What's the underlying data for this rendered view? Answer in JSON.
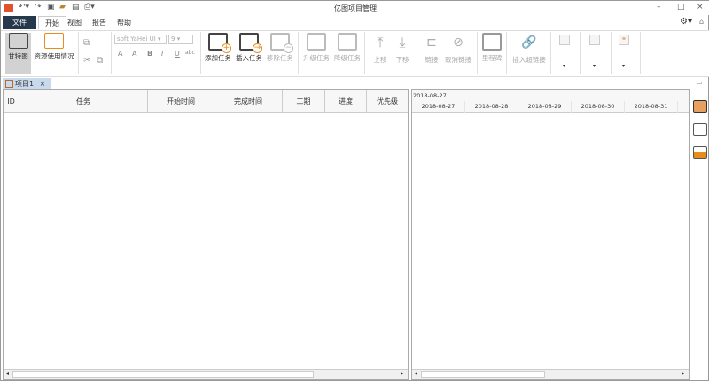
{
  "app": {
    "title": "亿图项目管理"
  },
  "menu": {
    "file": "文件",
    "tabs": [
      "开始",
      "视图",
      "报告",
      "帮助"
    ]
  },
  "ribbon": {
    "view": [
      "甘特图",
      "资源使用情况"
    ],
    "font": {
      "name": "soft YaHei UI",
      "size": "9",
      "styles": [
        "A",
        "A",
        "B",
        "I",
        "U",
        "abc"
      ]
    },
    "tasks": [
      "添加任务",
      "插入任务",
      "移除任务"
    ],
    "level": [
      "升级任务",
      "降级任务"
    ],
    "move": [
      "上移",
      "下移"
    ],
    "links": [
      "链接",
      "取消链接"
    ],
    "misc": [
      "里程碑",
      "插入超链接"
    ]
  },
  "doc_tab": {
    "label": "项目1",
    "close": "×"
  },
  "table": {
    "columns": [
      "ID",
      "任务",
      "开始时间",
      "完成时间",
      "工期",
      "进度",
      "优先级"
    ]
  },
  "gantt": {
    "top_date": "2018-08-27",
    "days": [
      "2018-08-27",
      "2018-08-28",
      "2018-08-29",
      "2018-08-30",
      "2018-08-31"
    ]
  }
}
